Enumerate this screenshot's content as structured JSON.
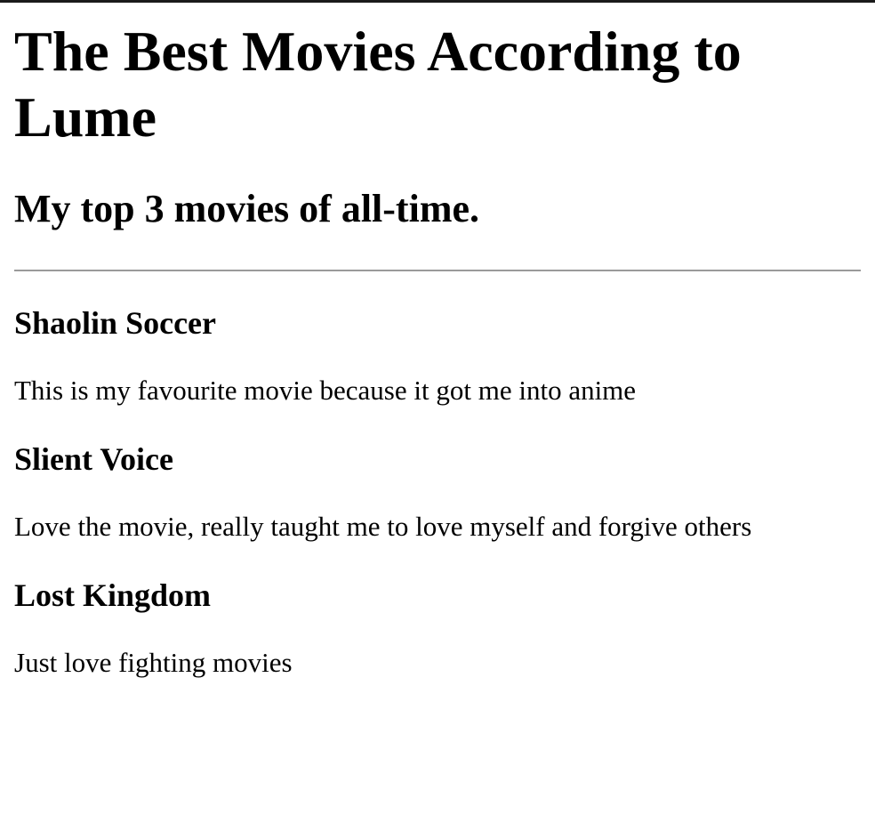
{
  "header": {
    "title": "The Best Movies According to Lume",
    "subtitle": "My top 3 movies of all-time."
  },
  "movies": [
    {
      "title": "Shaolin Soccer",
      "description": "This is my favourite movie because it got me into anime"
    },
    {
      "title": "Slient Voice",
      "description": "Love the movie, really taught me to love myself and forgive others"
    },
    {
      "title": "Lost Kingdom",
      "description": "Just love fighting movies"
    }
  ]
}
